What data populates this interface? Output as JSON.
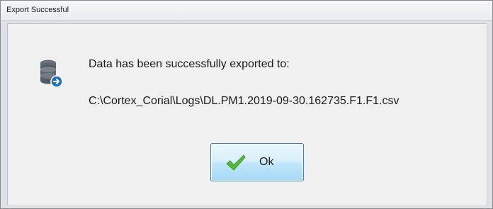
{
  "window": {
    "title": "Export Successful"
  },
  "dialog": {
    "icon": "database-export-icon",
    "message": "Data has been successfully exported to:",
    "path": "C:\\Cortex_Corial\\Logs\\DL.PM1.2019-09-30.162735.F1.F1.csv"
  },
  "buttons": {
    "ok_label": "Ok",
    "ok_icon": "checkmark-icon"
  },
  "colors": {
    "button_border": "#3c7fb1",
    "check_green": "#57b93b",
    "db_badge_blue": "#1e6fc1",
    "db_gray": "#5f6770"
  }
}
